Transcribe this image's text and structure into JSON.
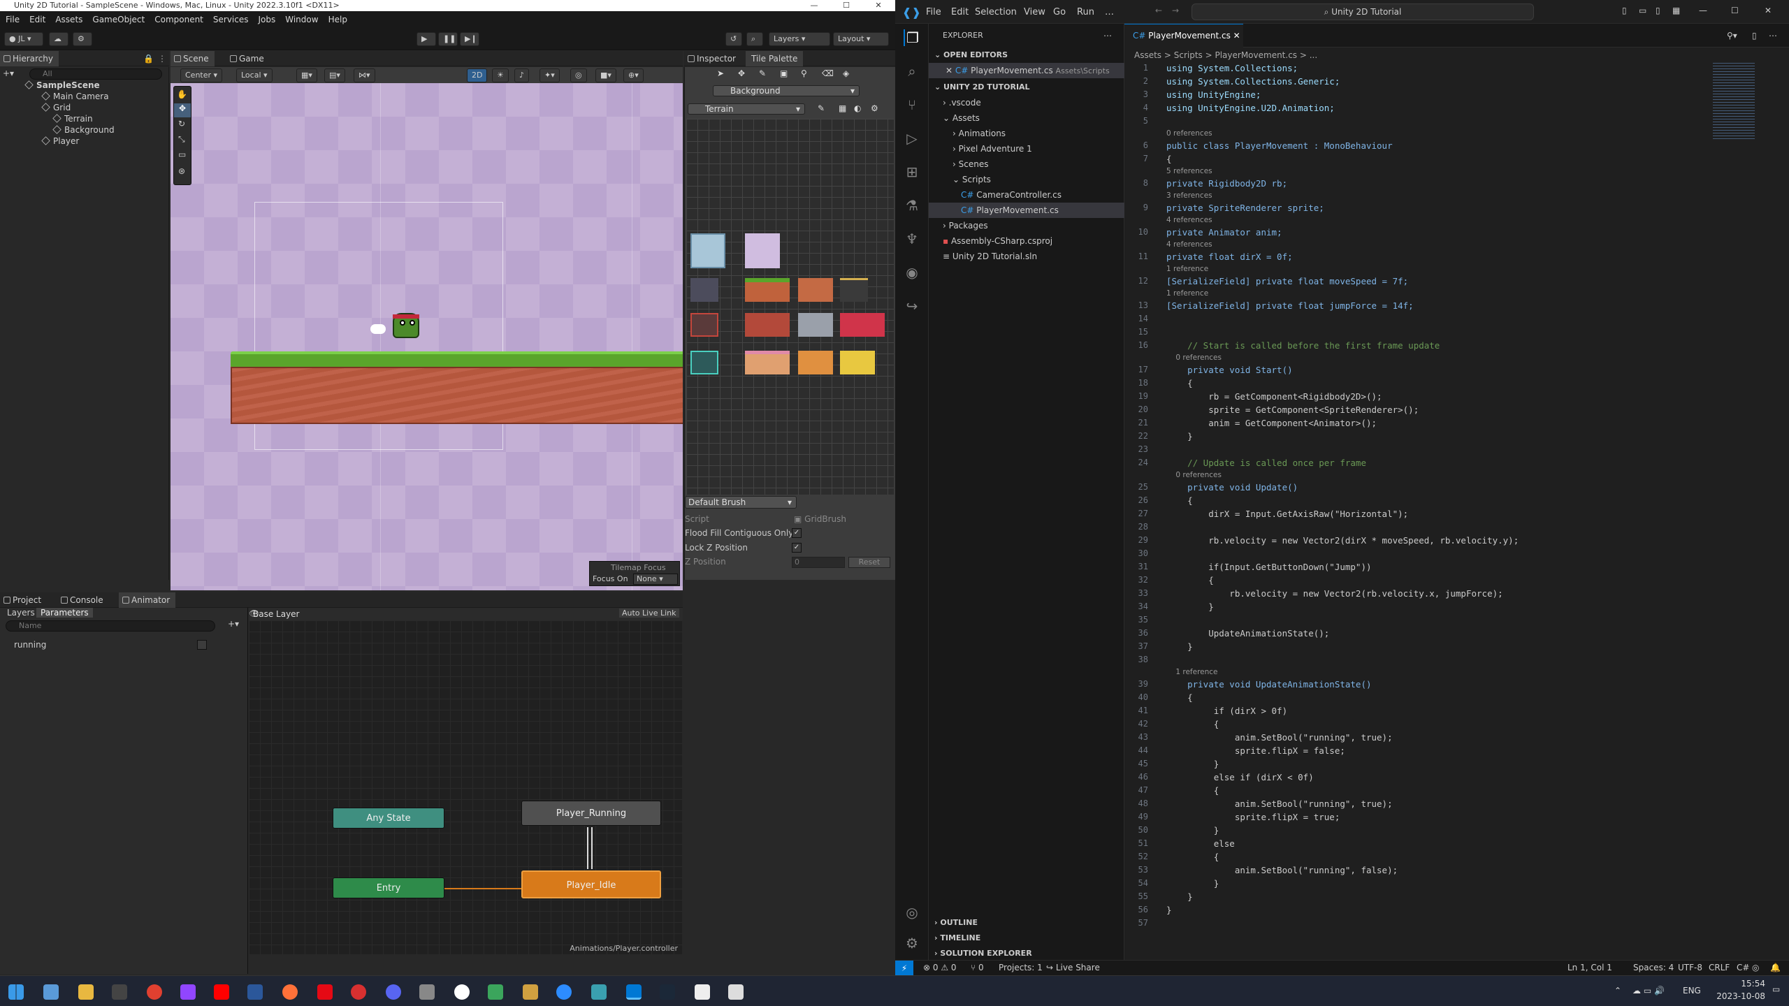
{
  "unity": {
    "title": "Unity 2D Tutorial - SampleScene - Windows, Mac, Linux - Unity 2022.3.10f1 <DX11>",
    "menu": [
      "File",
      "Edit",
      "Assets",
      "GameObject",
      "Component",
      "Services",
      "Jobs",
      "Window",
      "Help"
    ],
    "toolbar": {
      "account": "JL",
      "layers": "Layers",
      "layout": "Layout"
    },
    "hierarchy": {
      "tab": "Hierarchy",
      "search_placeholder": "All",
      "items": [
        "SampleScene",
        "Main Camera",
        "Grid",
        "Terrain",
        "Background",
        "Player"
      ]
    },
    "scene_tabs": [
      "Scene",
      "Game"
    ],
    "scene_toolbar": {
      "pivot": "Center",
      "space": "Local",
      "mode2d": "2D"
    },
    "tilemap_focus": {
      "title": "Tilemap Focus",
      "label": "Focus On",
      "value": "None"
    },
    "inspector_tabs": [
      "Inspector",
      "Tile Palette"
    ],
    "palette": {
      "name": "Background",
      "tilemap": "Terrain",
      "brush": "Default Brush",
      "script_label": "Script",
      "script_value": "GridBrush",
      "flood_fill": "Flood Fill Contiguous Only",
      "lock_z": "Lock Z Position",
      "z_position": "Z Position",
      "z_value": "0",
      "reset": "Reset"
    },
    "bottom_tabs": [
      "Project",
      "Console",
      "Animator"
    ],
    "animator": {
      "layers_tab": "Layers",
      "params_tab": "Parameters",
      "search_placeholder": "Name",
      "param": "running",
      "base_layer": "Base Layer",
      "auto_live": "Auto Live Link",
      "states": {
        "any": "Any State",
        "entry": "Entry",
        "running": "Player_Running",
        "idle": "Player_Idle"
      },
      "path": "Animations/Player.controller"
    }
  },
  "vscode": {
    "menu": [
      "File",
      "Edit",
      "Selection",
      "View",
      "Go",
      "Run",
      "…"
    ],
    "search": "Unity 2D Tutorial",
    "explorer": {
      "title": "EXPLORER",
      "open_editors": "OPEN EDITORS",
      "open_file": "PlayerMovement.cs",
      "open_file_path": "Assets\\Scripts",
      "project": "UNITY 2D TUTORIAL",
      "items": [
        ".vscode",
        "Assets",
        "Animations",
        "Pixel Adventure 1",
        "Scenes",
        "Scripts",
        "CameraController.cs",
        "PlayerMovement.cs",
        "Packages",
        "Assembly-CSharp.csproj",
        "Unity 2D Tutorial.sln"
      ],
      "bottom": [
        "OUTLINE",
        "TIMELINE",
        "SOLUTION EXPLORER"
      ]
    },
    "tab": "PlayerMovement.cs",
    "breadcrumb": "Assets > Scripts > PlayerMovement.cs > ...",
    "code": [
      {
        "n": "1",
        "t": "using System.Collections;"
      },
      {
        "n": "2",
        "t": "using System.Collections.Generic;"
      },
      {
        "n": "3",
        "t": "using UnityEngine;"
      },
      {
        "n": "4",
        "t": "using UnityEngine.U2D.Animation;"
      },
      {
        "n": "5",
        "t": ""
      },
      {
        "lens": "0 references"
      },
      {
        "n": "6",
        "t": "public class PlayerMovement : MonoBehaviour"
      },
      {
        "n": "7",
        "t": "{"
      },
      {
        "lens": "5 references"
      },
      {
        "n": "8",
        "t": "private Rigidbody2D rb;"
      },
      {
        "lens": "3 references"
      },
      {
        "n": "9",
        "t": "private SpriteRenderer sprite;"
      },
      {
        "lens": "4 references"
      },
      {
        "n": "10",
        "t": "private Animator anim;"
      },
      {
        "lens": "4 references"
      },
      {
        "n": "11",
        "t": "private float dirX = 0f;"
      },
      {
        "lens": "1 reference"
      },
      {
        "n": "12",
        "t": "[SerializeField] private float moveSpeed = 7f;"
      },
      {
        "lens": "1 reference"
      },
      {
        "n": "13",
        "t": "[SerializeField] private float jumpForce = 14f;"
      },
      {
        "n": "14",
        "t": ""
      },
      {
        "n": "15",
        "t": ""
      },
      {
        "n": "16",
        "t": "    // Start is called before the first frame update"
      },
      {
        "lens": "    0 references"
      },
      {
        "n": "17",
        "t": "    private void Start()"
      },
      {
        "n": "18",
        "t": "    {"
      },
      {
        "n": "19",
        "t": "        rb = GetComponent<Rigidbody2D>();"
      },
      {
        "n": "20",
        "t": "        sprite = GetComponent<SpriteRenderer>();"
      },
      {
        "n": "21",
        "t": "        anim = GetComponent<Animator>();"
      },
      {
        "n": "22",
        "t": "    }"
      },
      {
        "n": "23",
        "t": ""
      },
      {
        "n": "24",
        "t": "    // Update is called once per frame"
      },
      {
        "lens": "    0 references"
      },
      {
        "n": "25",
        "t": "    private void Update()"
      },
      {
        "n": "26",
        "t": "    {"
      },
      {
        "n": "27",
        "t": "        dirX = Input.GetAxisRaw(\"Horizontal\");"
      },
      {
        "n": "28",
        "t": ""
      },
      {
        "n": "29",
        "t": "        rb.velocity = new Vector2(dirX * moveSpeed, rb.velocity.y);"
      },
      {
        "n": "30",
        "t": ""
      },
      {
        "n": "31",
        "t": "        if(Input.GetButtonDown(\"Jump\"))"
      },
      {
        "n": "32",
        "t": "        {"
      },
      {
        "n": "33",
        "t": "            rb.velocity = new Vector2(rb.velocity.x, jumpForce);"
      },
      {
        "n": "34",
        "t": "        }"
      },
      {
        "n": "35",
        "t": ""
      },
      {
        "n": "36",
        "t": "        UpdateAnimationState();"
      },
      {
        "n": "37",
        "t": "    }"
      },
      {
        "n": "38",
        "t": ""
      },
      {
        "lens": "    1 reference"
      },
      {
        "n": "39",
        "t": "    private void UpdateAnimationState()"
      },
      {
        "n": "40",
        "t": "    {"
      },
      {
        "n": "41",
        "t": "         if (dirX > 0f)"
      },
      {
        "n": "42",
        "t": "         {"
      },
      {
        "n": "43",
        "t": "             anim.SetBool(\"running\", true);"
      },
      {
        "n": "44",
        "t": "             sprite.flipX = false;"
      },
      {
        "n": "45",
        "t": "         }"
      },
      {
        "n": "46",
        "t": "         else if (dirX < 0f)"
      },
      {
        "n": "47",
        "t": "         {"
      },
      {
        "n": "48",
        "t": "             anim.SetBool(\"running\", true);"
      },
      {
        "n": "49",
        "t": "             sprite.flipX = true;"
      },
      {
        "n": "50",
        "t": "         }"
      },
      {
        "n": "51",
        "t": "         else"
      },
      {
        "n": "52",
        "t": "         {"
      },
      {
        "n": "53",
        "t": "             anim.SetBool(\"running\", false);"
      },
      {
        "n": "54",
        "t": "         }"
      },
      {
        "n": "55",
        "t": "    }"
      },
      {
        "n": "56",
        "t": "}"
      },
      {
        "n": "57",
        "t": ""
      }
    ],
    "status": {
      "errors": "⊗ 0 ⚠ 0",
      "ports": "⑂ 0",
      "projects": "Projects: 1",
      "liveshare": "Live Share",
      "position": "Ln 1, Col 1",
      "spaces": "Spaces: 4",
      "encoding": "UTF-8",
      "eol": "CRLF",
      "lang": "C#"
    }
  },
  "taskbar": {
    "lang": "ENG",
    "time": "15:54",
    "date": "2023-10-08"
  },
  "colors": {
    "idle_state": "#d87a1a",
    "entry_state": "#2e8b4a",
    "any_state": "#3f8f80",
    "vs_accent": "#0078d4"
  }
}
